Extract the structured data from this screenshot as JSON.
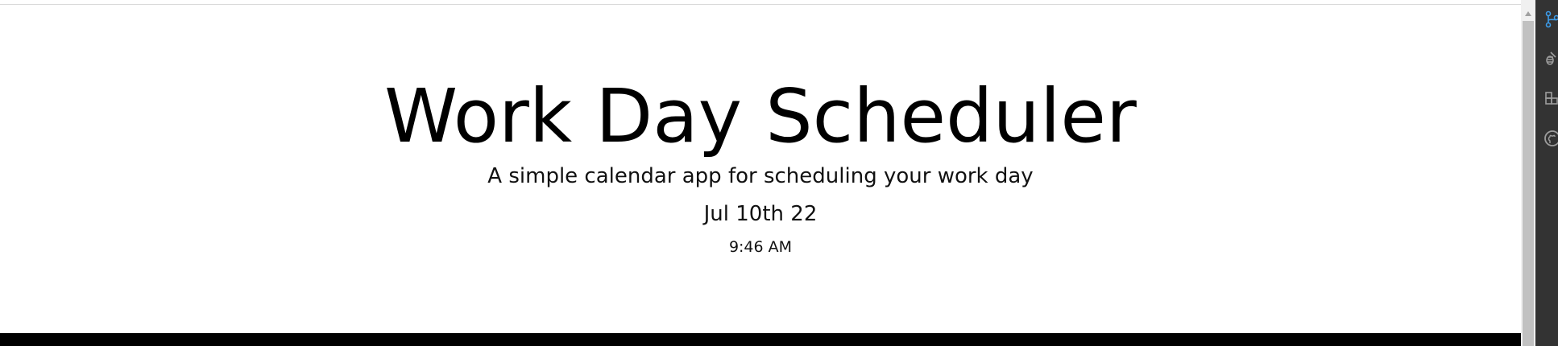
{
  "header": {
    "title": "Work Day Scheduler",
    "lead": "A simple calendar app for scheduling your work day",
    "current_day": "Jul 10th 22",
    "current_time": "9:46 AM"
  },
  "side_panel": {
    "icons": [
      "source-control-icon",
      "debug-icon",
      "extensions-icon",
      "github-icon"
    ]
  },
  "colors": {
    "background": "#ffffff",
    "text": "#000000",
    "bottom_bar": "#000000",
    "side_panel": "#333333",
    "scrollbar_thumb": "#c1c1c1"
  }
}
